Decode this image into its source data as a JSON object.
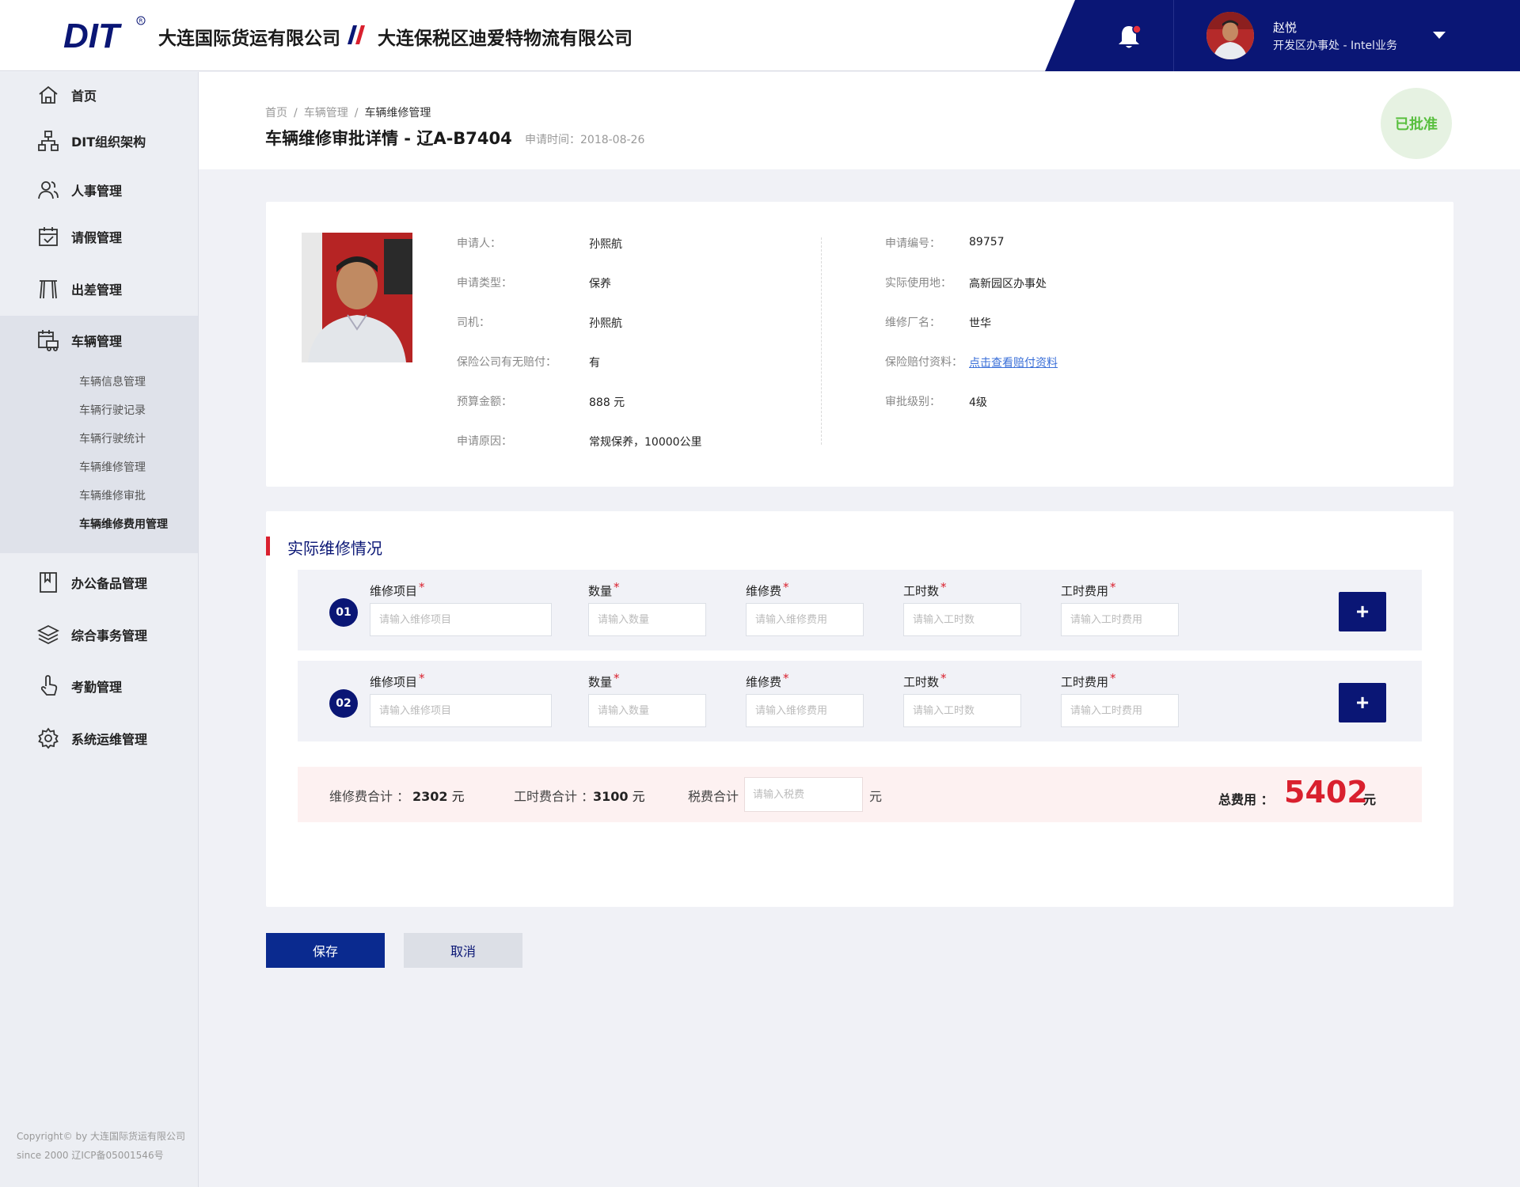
{
  "header": {
    "logo_text": "DIT",
    "company1": "大连国际货运有限公司",
    "company2": "大连保税区迪爱特物流有限公司",
    "user_name": "赵悦",
    "user_dept": "开发区办事处 - Intel业务",
    "brand_color": "#0a1675",
    "accent_color": "#d9202e"
  },
  "sidebar": {
    "items": [
      {
        "label": "首页",
        "icon": "home-icon"
      },
      {
        "label": "DIT组织架构",
        "icon": "org-chart-icon"
      },
      {
        "label": "人事管理",
        "icon": "users-icon"
      },
      {
        "label": "请假管理",
        "icon": "calendar-check-icon"
      },
      {
        "label": "出差管理",
        "icon": "gate-icon"
      },
      {
        "label": "车辆管理",
        "icon": "vehicle-icon"
      },
      {
        "label": "办公备品管理",
        "icon": "bookmark-icon"
      },
      {
        "label": "综合事务管理",
        "icon": "layers-icon"
      },
      {
        "label": "考勤管理",
        "icon": "hand-touch-icon"
      },
      {
        "label": "系统运维管理",
        "icon": "gear-icon"
      }
    ],
    "sub_items": [
      {
        "label": "车辆信息管理"
      },
      {
        "label": "车辆行驶记录"
      },
      {
        "label": "车辆行驶统计"
      },
      {
        "label": "车辆维修管理"
      },
      {
        "label": "车辆维修审批"
      },
      {
        "label": "车辆维修费用管理"
      }
    ],
    "copyright_line1": "Copyright© by 大连国际货运有限公司",
    "copyright_line2": "since 2000 辽ICP备05001546号"
  },
  "page": {
    "breadcrumb": [
      "首页",
      "车辆管理",
      "车辆维修管理"
    ],
    "title": "车辆维修审批详情 - 辽A-B7404",
    "apply_time": "申请时间：2018-08-26",
    "status": "已批准"
  },
  "info": {
    "left": [
      {
        "label": "申请人：",
        "value": "孙熙航"
      },
      {
        "label": "申请类型：",
        "value": "保养"
      },
      {
        "label": "司机：",
        "value": "孙熙航"
      },
      {
        "label": "保险公司有无赔付：",
        "value": "有"
      },
      {
        "label": "预算金额：",
        "value": "888 元"
      },
      {
        "label": "申请原因：",
        "value": "常规保养，10000公里"
      }
    ],
    "right": [
      {
        "label": "申请编号：",
        "value": "89757"
      },
      {
        "label": "实际使用地：",
        "value": "高新园区办事处"
      },
      {
        "label": "维修厂名：",
        "value": "世华"
      },
      {
        "label": "保险赔付资料：",
        "value": "点击查看赔付资料"
      },
      {
        "label": "审批级别：",
        "value": "4级"
      }
    ]
  },
  "repair": {
    "section_title": "实际维修情况",
    "rows": [
      {
        "num": "01",
        "fields": [
          {
            "label": "维修项目",
            "placeholder": "请输入维修项目"
          },
          {
            "label": "数量",
            "placeholder": "请输入数量"
          },
          {
            "label": "维修费",
            "placeholder": "请输入维修费用"
          },
          {
            "label": "工时数",
            "placeholder": "请输入工时数"
          },
          {
            "label": "工时费用",
            "placeholder": "请输入工时费用"
          }
        ],
        "add_label": "+"
      },
      {
        "num": "02",
        "fields": [
          {
            "label": "维修项目",
            "placeholder": "请输入维修项目"
          },
          {
            "label": "数量",
            "placeholder": "请输入数量"
          },
          {
            "label": "维修费",
            "placeholder": "请输入维修费用"
          },
          {
            "label": "工时数",
            "placeholder": "请输入工时数"
          },
          {
            "label": "工时费用",
            "placeholder": "请输入工时费用"
          }
        ],
        "add_label": "+"
      }
    ],
    "required_mark": "*",
    "totals": {
      "repair_fee_label": "维修费合计 ：",
      "repair_fee_value": "2302",
      "labor_fee_label": "工时费合计 ：",
      "labor_fee_value": "3100",
      "tax_label": "税费合计",
      "tax_placeholder": "请输入税费",
      "unit": "元",
      "grand_label": "总费用 ：",
      "grand_value": "5402"
    }
  },
  "actions": {
    "save": "保存",
    "cancel": "取消"
  }
}
